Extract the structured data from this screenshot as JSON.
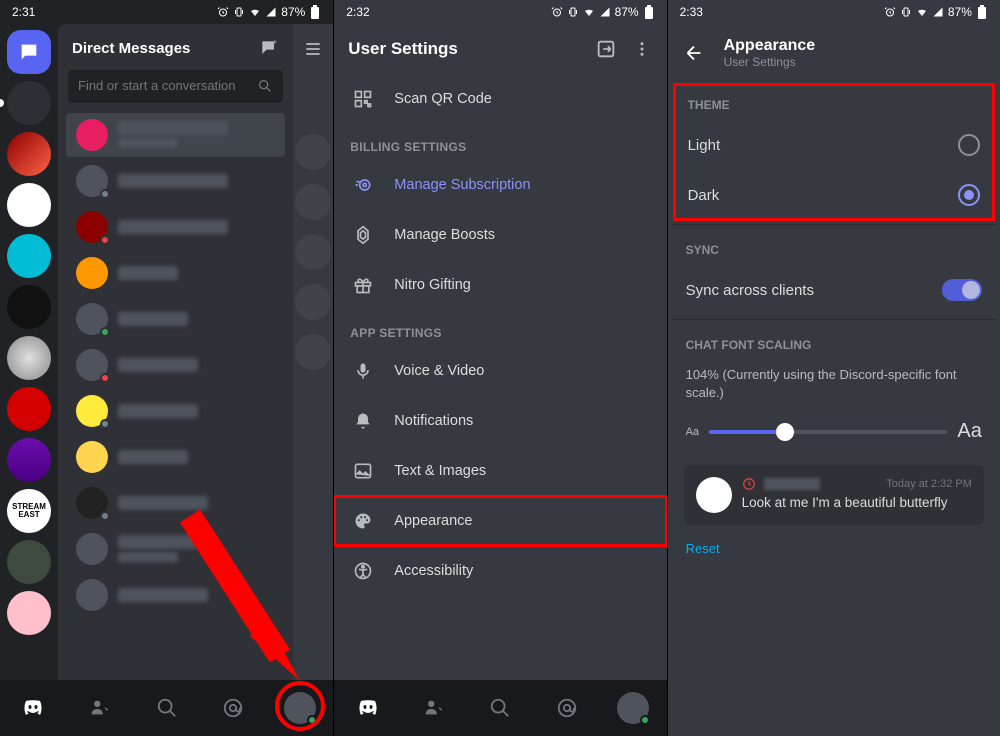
{
  "status": {
    "times": [
      "2:31",
      "2:32",
      "2:33"
    ],
    "battery": "87%"
  },
  "screen1": {
    "dm_header": "Direct Messages",
    "search_placeholder": "Find or start a conversation"
  },
  "screen2": {
    "title": "User Settings",
    "scan_qr": "Scan QR Code",
    "section_billing": "BILLING SETTINGS",
    "manage_sub": "Manage Subscription",
    "manage_boosts": "Manage Boosts",
    "nitro_gifting": "Nitro Gifting",
    "section_app": "APP SETTINGS",
    "voice_video": "Voice & Video",
    "notifications": "Notifications",
    "text_images": "Text & Images",
    "appearance": "Appearance",
    "accessibility": "Accessibility"
  },
  "screen3": {
    "title": "Appearance",
    "subtitle": "User Settings",
    "section_theme": "THEME",
    "light": "Light",
    "dark": "Dark",
    "section_sync": "SYNC",
    "sync_label": "Sync across clients",
    "section_font": "CHAT FONT SCALING",
    "font_desc": "104% (Currently using the Discord-specific font scale.)",
    "aa_small": "Aa",
    "aa_large": "Aa",
    "preview_time": "Today at 2:32 PM",
    "preview_msg": "Look at me I'm a beautiful butterfly",
    "reset": "Reset"
  }
}
